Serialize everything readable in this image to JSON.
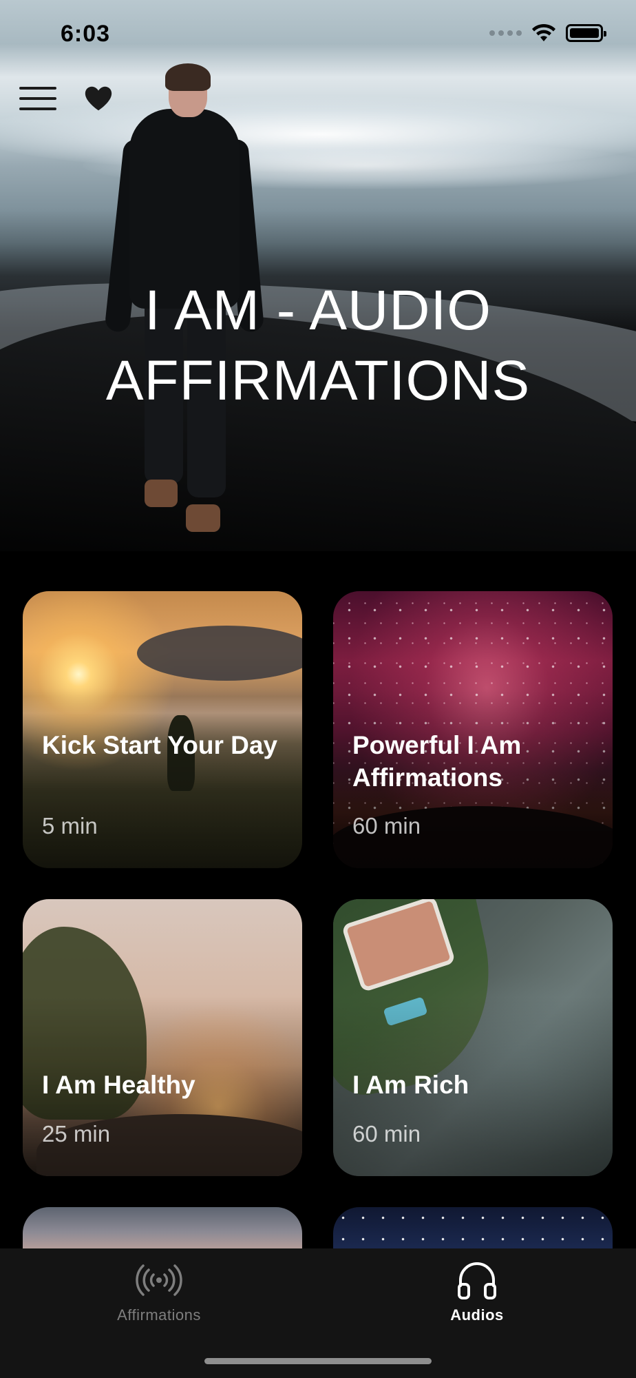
{
  "status_bar": {
    "time": "6:03"
  },
  "header": {
    "menu_icon": "hamburger-menu-icon",
    "favorites_icon": "heart-icon"
  },
  "hero": {
    "title": "I AM - AUDIO AFFIRMATIONS"
  },
  "audios": [
    {
      "title": "Kick Start Your Day",
      "duration": "5 min"
    },
    {
      "title": "Powerful I Am Affirmations",
      "duration": "60 min"
    },
    {
      "title": "I Am Healthy",
      "duration": "25 min"
    },
    {
      "title": "I Am Rich",
      "duration": "60 min"
    }
  ],
  "tabbar": {
    "tabs": [
      {
        "label": "Affirmations",
        "icon": "broadcast-icon",
        "selected": false
      },
      {
        "label": "Audios",
        "icon": "headphones-icon",
        "selected": true
      }
    ]
  },
  "colors": {
    "background": "#000000",
    "tabbar": "#141414",
    "tab_active": "#ffffff",
    "tab_inactive": "#7e7e7e"
  }
}
